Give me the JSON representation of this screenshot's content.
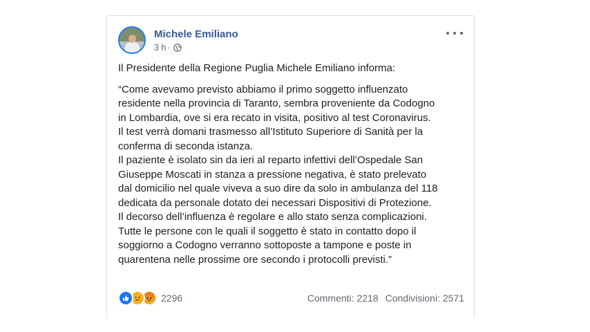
{
  "post": {
    "author": "Michele Emiliano",
    "time": "3 h",
    "separator": "·",
    "privacy_icon": "globe-icon",
    "more_icon": "more-options-icon",
    "intro": "Il Presidente della Regione Puglia Michele Emiliano informa:",
    "lines": [
      "“Come avevamo previsto abbiamo il primo soggetto influenzato",
      "residente nella provincia di Taranto, sembra proveniente da Codogno",
      "in Lombardia, ove si era recato in visita, positivo al test Coronavirus.",
      "Il test verrà domani trasmesso all’Istituto Superiore di Sanità per la",
      "conferma di seconda istanza.",
      "Il paziente è isolato sin da ieri al reparto infettivi dell’Ospedale San",
      "Giuseppe Moscati in stanza a pressione negativa, è stato prelevato",
      "dal domicilio nel quale viveva a suo dire da solo in ambulanza del 118",
      "dedicata da personale dotato dei necessari Dispositivi di Protezione.",
      "Il decorso dell’influenza è regolare e allo stato senza complicazioni.",
      "Tutte le persone con le quali il soggetto è stato in contatto dopo il",
      "soggiorno a Codogno verranno sottoposte a tampone e poste in",
      "quarentena nelle prossime ore secondo i protocolli previsti.”"
    ]
  },
  "footer": {
    "reactions": [
      "like",
      "sad",
      "angry"
    ],
    "reaction_count": "2296",
    "comments": "Commenti: 2218",
    "shares": "Condivisioni: 2571"
  },
  "colors": {
    "author_link": "#385898",
    "meta_text": "#606770",
    "like": "#1877f2",
    "sad": "#f7b125",
    "angry": "#e9710f"
  }
}
